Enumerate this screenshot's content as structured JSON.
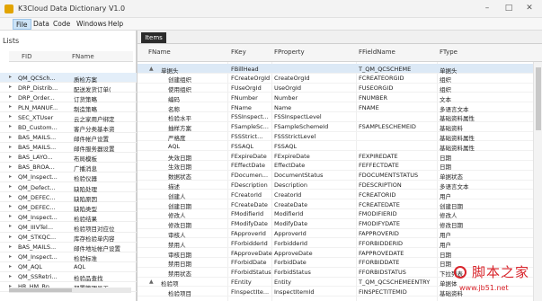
{
  "window": {
    "title": "K3Cloud Data Dictionary V1.0",
    "controls": [
      "–",
      "□",
      "✕"
    ]
  },
  "menu": [
    "File",
    "Data",
    "Code",
    "Windows",
    "Help"
  ],
  "left_panel": {
    "title": "Lists",
    "columns": [
      "FID",
      "FName"
    ],
    "rows": [
      {
        "fid": "QM_QCSch...",
        "fname": "质检方案",
        "selected": true
      },
      {
        "fid": "DRP_Distrib...",
        "fname": "配送发货订单(",
        "selected": false
      },
      {
        "fid": "DRP_Order...",
        "fname": "订货策略",
        "selected": false
      },
      {
        "fid": "PLN_MANUF...",
        "fname": "制造策略",
        "selected": false
      },
      {
        "fid": "SEC_XTUser",
        "fname": "云之家用户绑定",
        "selected": false
      },
      {
        "fid": "BD_Custom...",
        "fname": "客户分类基本资",
        "selected": false
      },
      {
        "fid": "BAS_MAILS...",
        "fname": "邮件帐户设置",
        "selected": false
      },
      {
        "fid": "BAS_MAILS...",
        "fname": "邮件服务器设置",
        "selected": false
      },
      {
        "fid": "BAS_LAYO...",
        "fname": "布局模板",
        "selected": false
      },
      {
        "fid": "BAS_BROA...",
        "fname": "广播消息",
        "selected": false
      },
      {
        "fid": "QM_Inspect...",
        "fname": "检验仪器",
        "selected": false
      },
      {
        "fid": "QM_Defect...",
        "fname": "缺陷处理",
        "selected": false
      },
      {
        "fid": "QM_DEFEC...",
        "fname": "缺陷原因",
        "selected": false
      },
      {
        "fid": "QM_DEFEC...",
        "fname": "缺陷类型",
        "selected": false
      },
      {
        "fid": "QM_Inspect...",
        "fname": "检验结果",
        "selected": false
      },
      {
        "fid": "QM_IIIVTel...",
        "fname": "检验项目对应位",
        "selected": false
      },
      {
        "fid": "QM_STKQC...",
        "fname": "库存检验单内容",
        "selected": false
      },
      {
        "fid": "BAS_MAILS...",
        "fname": "邮件地址帐户设置",
        "selected": false
      },
      {
        "fid": "QM_Inspect...",
        "fname": "检验标准",
        "selected": false
      },
      {
        "fid": "QM_AQL",
        "fname": "AQL",
        "selected": false
      },
      {
        "fid": "QM_SSRetri...",
        "fname": "检验品查找",
        "selected": false
      },
      {
        "fid": "HR_HM_Bn...",
        "fname": "部署管理员工",
        "selected": false
      }
    ]
  },
  "tabs": [
    "Items"
  ],
  "grid": {
    "columns": [
      "FName",
      "FKey",
      "FProperty",
      "FFieldName",
      "FType"
    ],
    "rows": [
      {
        "exp": "▲",
        "child": false,
        "sel": true,
        "c0": "单据头",
        "c1": "FBillHead",
        "c2": "",
        "c3": "T_QM_QCSCHEME",
        "c4": "单据头"
      },
      {
        "exp": "",
        "child": true,
        "sel": false,
        "c0": "创建组织",
        "c1": "FCreateOrgId",
        "c2": "CreateOrgId",
        "c3": "FCREATEORGID",
        "c4": "组织"
      },
      {
        "exp": "",
        "child": true,
        "sel": false,
        "c0": "使用组织",
        "c1": "FUseOrgId",
        "c2": "UseOrgId",
        "c3": "FUSEORGID",
        "c4": "组织"
      },
      {
        "exp": "",
        "child": true,
        "sel": false,
        "c0": "编码",
        "c1": "FNumber",
        "c2": "Number",
        "c3": "FNUMBER",
        "c4": "文本"
      },
      {
        "exp": "",
        "child": true,
        "sel": false,
        "c0": "名称",
        "c1": "FName",
        "c2": "Name",
        "c3": "FNAME",
        "c4": "多语言文本"
      },
      {
        "exp": "",
        "child": true,
        "sel": false,
        "c0": "检验水平",
        "c1": "FSSInspect...",
        "c2": "FSSInspectLevel",
        "c3": "",
        "c4": "基础资料属性"
      },
      {
        "exp": "",
        "child": true,
        "sel": false,
        "c0": "抽样方案",
        "c1": "FSampleSc...",
        "c2": "FSampleSchemeId",
        "c3": "FSAMPLESCHEMEID",
        "c4": "基础资料"
      },
      {
        "exp": "",
        "child": true,
        "sel": false,
        "c0": "严格度",
        "c1": "FSSStrict...",
        "c2": "FSSStrictLevel",
        "c3": "",
        "c4": "基础资料属性"
      },
      {
        "exp": "",
        "child": true,
        "sel": false,
        "c0": "AQL",
        "c1": "FSSAQL",
        "c2": "FSSAQL",
        "c3": "",
        "c4": "基础资料属性"
      },
      {
        "exp": "",
        "child": true,
        "sel": false,
        "c0": "失效日期",
        "c1": "FExpireDate",
        "c2": "FExpireDate",
        "c3": "FEXPIREDATE",
        "c4": "日期"
      },
      {
        "exp": "",
        "child": true,
        "sel": false,
        "c0": "生效日期",
        "c1": "FEffectDate",
        "c2": "EffectDate",
        "c3": "FEFFECTDATE",
        "c4": "日期"
      },
      {
        "exp": "",
        "child": true,
        "sel": false,
        "c0": "数据状态",
        "c1": "FDocumen...",
        "c2": "DocumentStatus",
        "c3": "FDOCUMENTSTATUS",
        "c4": "单据状态"
      },
      {
        "exp": "",
        "child": true,
        "sel": false,
        "c0": "描述",
        "c1": "FDescription",
        "c2": "Description",
        "c3": "FDESCRIPTION",
        "c4": "多语言文本"
      },
      {
        "exp": "",
        "child": true,
        "sel": false,
        "c0": "创建人",
        "c1": "FCreatorId",
        "c2": "CreatorId",
        "c3": "FCREATORID",
        "c4": "用户"
      },
      {
        "exp": "",
        "child": true,
        "sel": false,
        "c0": "创建日期",
        "c1": "FCreateDate",
        "c2": "CreateDate",
        "c3": "FCREATEDATE",
        "c4": "创建日期"
      },
      {
        "exp": "",
        "child": true,
        "sel": false,
        "c0": "修改人",
        "c1": "FModifierId",
        "c2": "ModifierId",
        "c3": "FMODIFIERID",
        "c4": "修改人"
      },
      {
        "exp": "",
        "child": true,
        "sel": false,
        "c0": "修改日期",
        "c1": "FModifyDate",
        "c2": "ModifyDate",
        "c3": "FMODIFYDATE",
        "c4": "修改日期"
      },
      {
        "exp": "",
        "child": true,
        "sel": false,
        "c0": "审核人",
        "c1": "FApproverId",
        "c2": "ApproverId",
        "c3": "FAPPROVERID",
        "c4": "用户"
      },
      {
        "exp": "",
        "child": true,
        "sel": false,
        "c0": "禁用人",
        "c1": "FForbidderId",
        "c2": "ForbidderId",
        "c3": "FFORBIDDERID",
        "c4": "用户"
      },
      {
        "exp": "",
        "child": true,
        "sel": false,
        "c0": "审核日期",
        "c1": "FApproveDate",
        "c2": "ApproveDate",
        "c3": "FAPPROVEDATE",
        "c4": "日期"
      },
      {
        "exp": "",
        "child": true,
        "sel": false,
        "c0": "禁用日期",
        "c1": "FForbidDate",
        "c2": "ForbidDate",
        "c3": "FFORBIDDATE",
        "c4": "日期"
      },
      {
        "exp": "",
        "child": true,
        "sel": false,
        "c0": "禁用状态",
        "c1": "FForbidStatus",
        "c2": "ForbidStatus",
        "c3": "FFORBIDSTATUS",
        "c4": "下拉列表"
      },
      {
        "exp": "▲",
        "child": false,
        "sel": false,
        "c0": "检验项",
        "c1": "FEntity",
        "c2": "Entity",
        "c3": "T_QM_QCSCHEMEENTRY",
        "c4": "单据体"
      },
      {
        "exp": "",
        "child": true,
        "sel": false,
        "c0": "检验项目",
        "c1": "FInspectIte...",
        "c2": "InspectItemId",
        "c3": "FINSPECTITEMID",
        "c4": "基础资料"
      }
    ]
  },
  "watermark": {
    "text": "脚本之家",
    "url": "www.jb51.net"
  },
  "colors": {
    "accent": "#2b2b2b",
    "selection": "#dce9f6",
    "watermark": "#d8232a"
  }
}
